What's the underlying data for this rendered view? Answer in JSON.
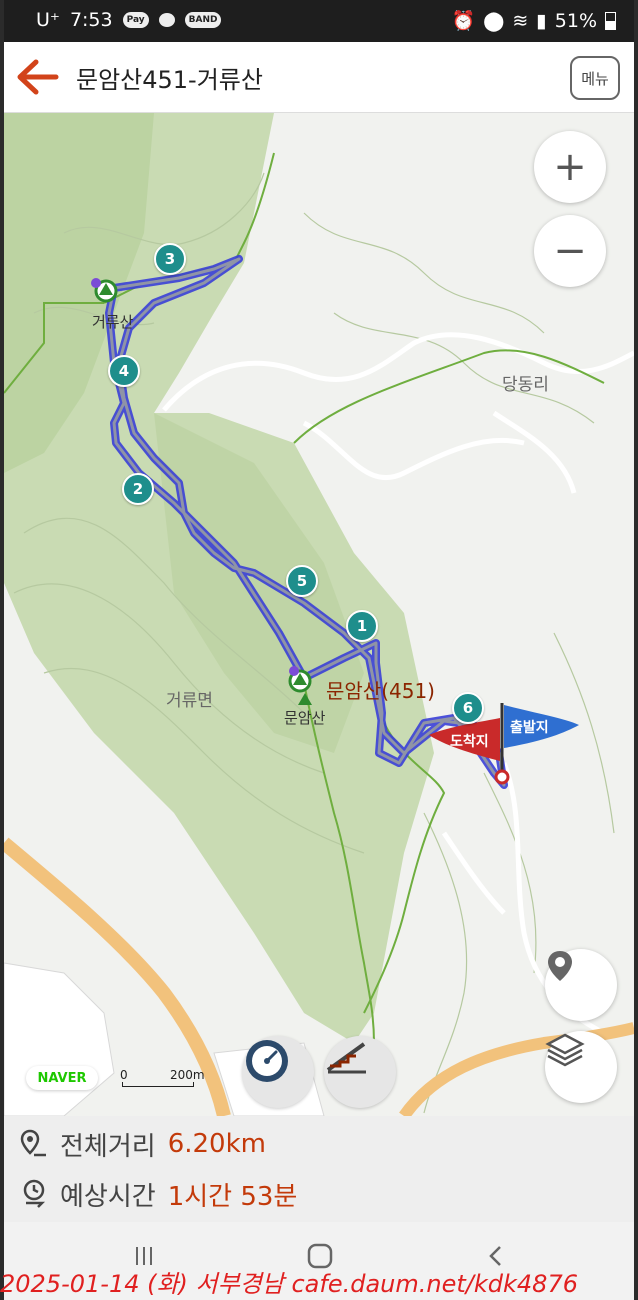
{
  "status_bar": {
    "carrier": "U⁺",
    "time": "7:53",
    "badges": [
      "Pay",
      "BAND"
    ],
    "battery": "51%"
  },
  "header": {
    "back_icon": "back-arrow-icon",
    "title": "문암산451-거류산",
    "menu_label": "메뉴"
  },
  "map": {
    "zoom_in": "+",
    "zoom_out": "−",
    "area_labels": [
      "당동리",
      "거류면"
    ],
    "peaks": [
      {
        "name": "거류산"
      },
      {
        "name": "문암산"
      }
    ],
    "peak_main_label": "문암산(451)",
    "waypoints": [
      "1",
      "2",
      "3",
      "4",
      "5",
      "6"
    ],
    "start_flag": "출발지",
    "end_flag": "도착지",
    "provider_badge": "NAVER",
    "scale_zero": "0",
    "scale_label": "200m"
  },
  "info": {
    "distance_label": "전체거리",
    "distance_value": "6.20km",
    "time_label": "예상시간",
    "time_value": "1시간 53분"
  },
  "watermark": "2025-01-14 (화) 서부경남 cafe.daum.net/kdk4876",
  "colors": {
    "accent": "#c33a0a",
    "route": "#3a3fd6",
    "marker": "#1e8e8c",
    "flag_start": "#2f6fd1",
    "flag_end": "#c92a2a"
  }
}
